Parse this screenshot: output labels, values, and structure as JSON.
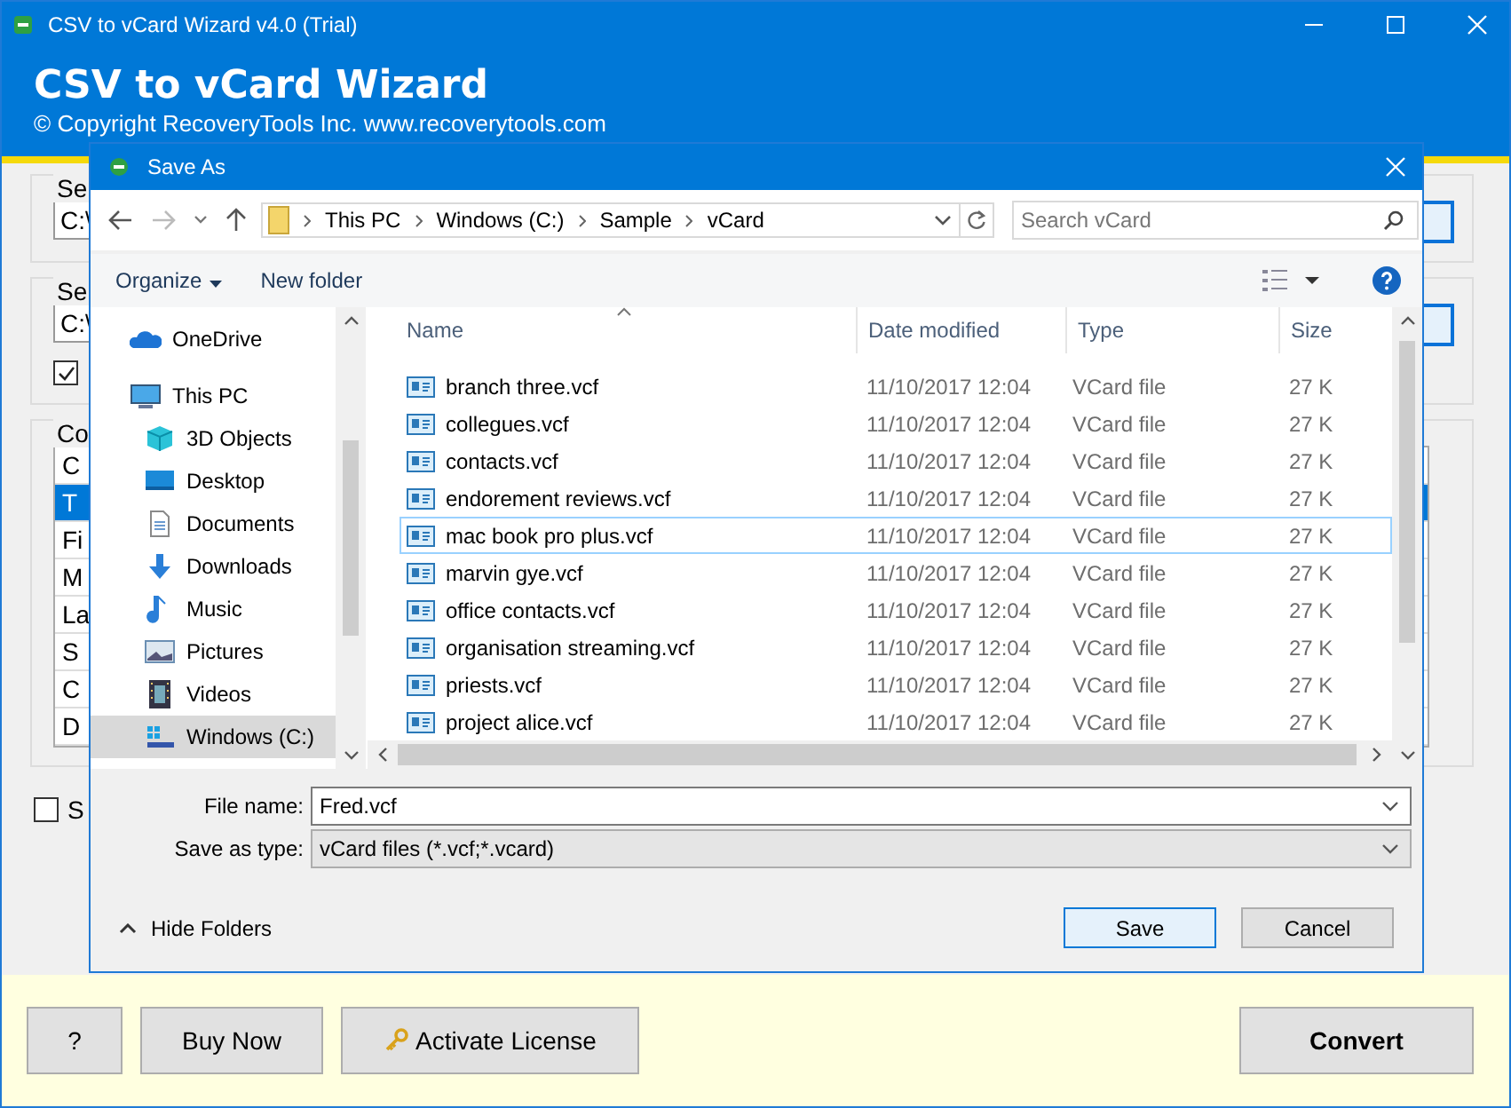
{
  "window": {
    "title": "CSV to vCard Wizard v4.0 (Trial)"
  },
  "header": {
    "title": "CSV to vCard Wizard",
    "copyright": "© Copyright RecoveryTools Inc. www.recoverytools.com"
  },
  "background": {
    "groups": [
      {
        "label": "Se",
        "path": "C:\\"
      },
      {
        "label": "Se",
        "path": "C:\\",
        "checked": true
      }
    ],
    "list_group": {
      "label": "Co",
      "header": "C",
      "items": [
        {
          "text": "T",
          "selected": true
        },
        {
          "text": "Fi",
          "selected": false
        },
        {
          "text": "M",
          "selected": false
        },
        {
          "text": "La",
          "selected": false
        },
        {
          "text": "S",
          "selected": false
        },
        {
          "text": "C",
          "selected": false
        },
        {
          "text": "D",
          "selected": false
        }
      ]
    },
    "option": {
      "label": "S",
      "checked": false
    }
  },
  "dialog": {
    "title": "Save As",
    "breadcrumb": [
      "This PC",
      "Windows (C:)",
      "Sample",
      "vCard"
    ],
    "search": {
      "placeholder": "Search vCard"
    },
    "toolbar": [
      "Organize",
      "New folder"
    ],
    "nav": [
      {
        "label": "OneDrive",
        "kind": "cloud",
        "selected": false
      },
      {
        "label": "This PC",
        "kind": "pc",
        "selected": false,
        "children": [
          {
            "label": "3D Objects",
            "kind": "cube",
            "selected": false
          },
          {
            "label": "Desktop",
            "kind": "desktop",
            "selected": false
          },
          {
            "label": "Documents",
            "kind": "document",
            "selected": false
          },
          {
            "label": "Downloads",
            "kind": "download",
            "selected": false
          },
          {
            "label": "Music",
            "kind": "music",
            "selected": false
          },
          {
            "label": "Pictures",
            "kind": "picture",
            "selected": false
          },
          {
            "label": "Videos",
            "kind": "video",
            "selected": false
          },
          {
            "label": "Windows (C:)",
            "kind": "drive",
            "selected": true
          }
        ]
      }
    ],
    "columns": [
      "Name",
      "Date modified",
      "Type",
      "Size"
    ],
    "files": [
      {
        "name": "branch three.vcf",
        "date": "11/10/2017 12:04",
        "type": "VCard file",
        "size": "27 K",
        "selected": false
      },
      {
        "name": "collegues.vcf",
        "date": "11/10/2017 12:04",
        "type": "VCard file",
        "size": "27 K",
        "selected": false
      },
      {
        "name": "contacts.vcf",
        "date": "11/10/2017 12:04",
        "type": "VCard file",
        "size": "27 K",
        "selected": false
      },
      {
        "name": "endorement reviews.vcf",
        "date": "11/10/2017 12:04",
        "type": "VCard file",
        "size": "27 K",
        "selected": false
      },
      {
        "name": "mac book pro plus.vcf",
        "date": "11/10/2017 12:04",
        "type": "VCard file",
        "size": "27 K",
        "selected": true
      },
      {
        "name": "marvin gye.vcf",
        "date": "11/10/2017 12:04",
        "type": "VCard file",
        "size": "27 K",
        "selected": false
      },
      {
        "name": "office contacts.vcf",
        "date": "11/10/2017 12:04",
        "type": "VCard file",
        "size": "27 K",
        "selected": false
      },
      {
        "name": "organisation streaming.vcf",
        "date": "11/10/2017 12:04",
        "type": "VCard file",
        "size": "27 K",
        "selected": false
      },
      {
        "name": "priests.vcf",
        "date": "11/10/2017 12:04",
        "type": "VCard file",
        "size": "27 K",
        "selected": false
      },
      {
        "name": "project alice.vcf",
        "date": "11/10/2017 12:04",
        "type": "VCard file",
        "size": "27 K",
        "selected": false
      }
    ],
    "file_name": {
      "label": "File name:",
      "value": "Fred.vcf"
    },
    "save_type": {
      "label": "Save as type:",
      "value": "vCard files (*.vcf;*.vcard)"
    },
    "hide_folders": "Hide Folders",
    "buttons": [
      "Save",
      "Cancel"
    ]
  },
  "footer_buttons": [
    "?",
    "Buy Now",
    "Activate License"
  ],
  "convert_button": "Convert"
}
